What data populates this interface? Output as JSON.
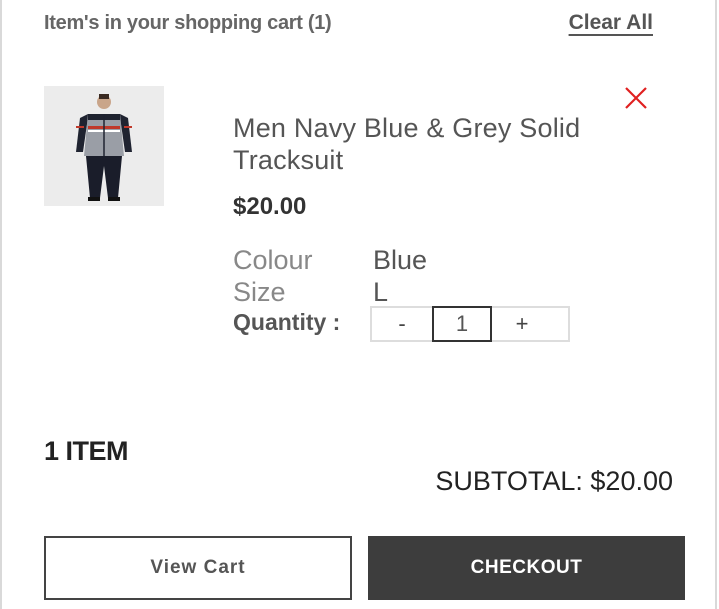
{
  "cart": {
    "title": "Item's in your shopping cart (1)",
    "clear_all_label": "Clear All"
  },
  "item": {
    "image_icon": "tracksuit-photo",
    "remove_icon": "close-icon",
    "remove_color": "#e02020",
    "name": "Men Navy Blue & Grey Solid Tracksuit",
    "price": "$20.00",
    "attributes": [
      {
        "label": "Colour",
        "value": "Blue"
      },
      {
        "label": "Size",
        "value": "L"
      }
    ],
    "quantity_label": "Quantity :",
    "quantity": "1",
    "decrement_label": "-",
    "increment_label": "+"
  },
  "summary": {
    "item_count": "1 ITEM",
    "subtotal": "SUBTOTAL: $20.00"
  },
  "actions": {
    "view_cart_label": "View Cart",
    "checkout_label": "CHECKOUT"
  }
}
